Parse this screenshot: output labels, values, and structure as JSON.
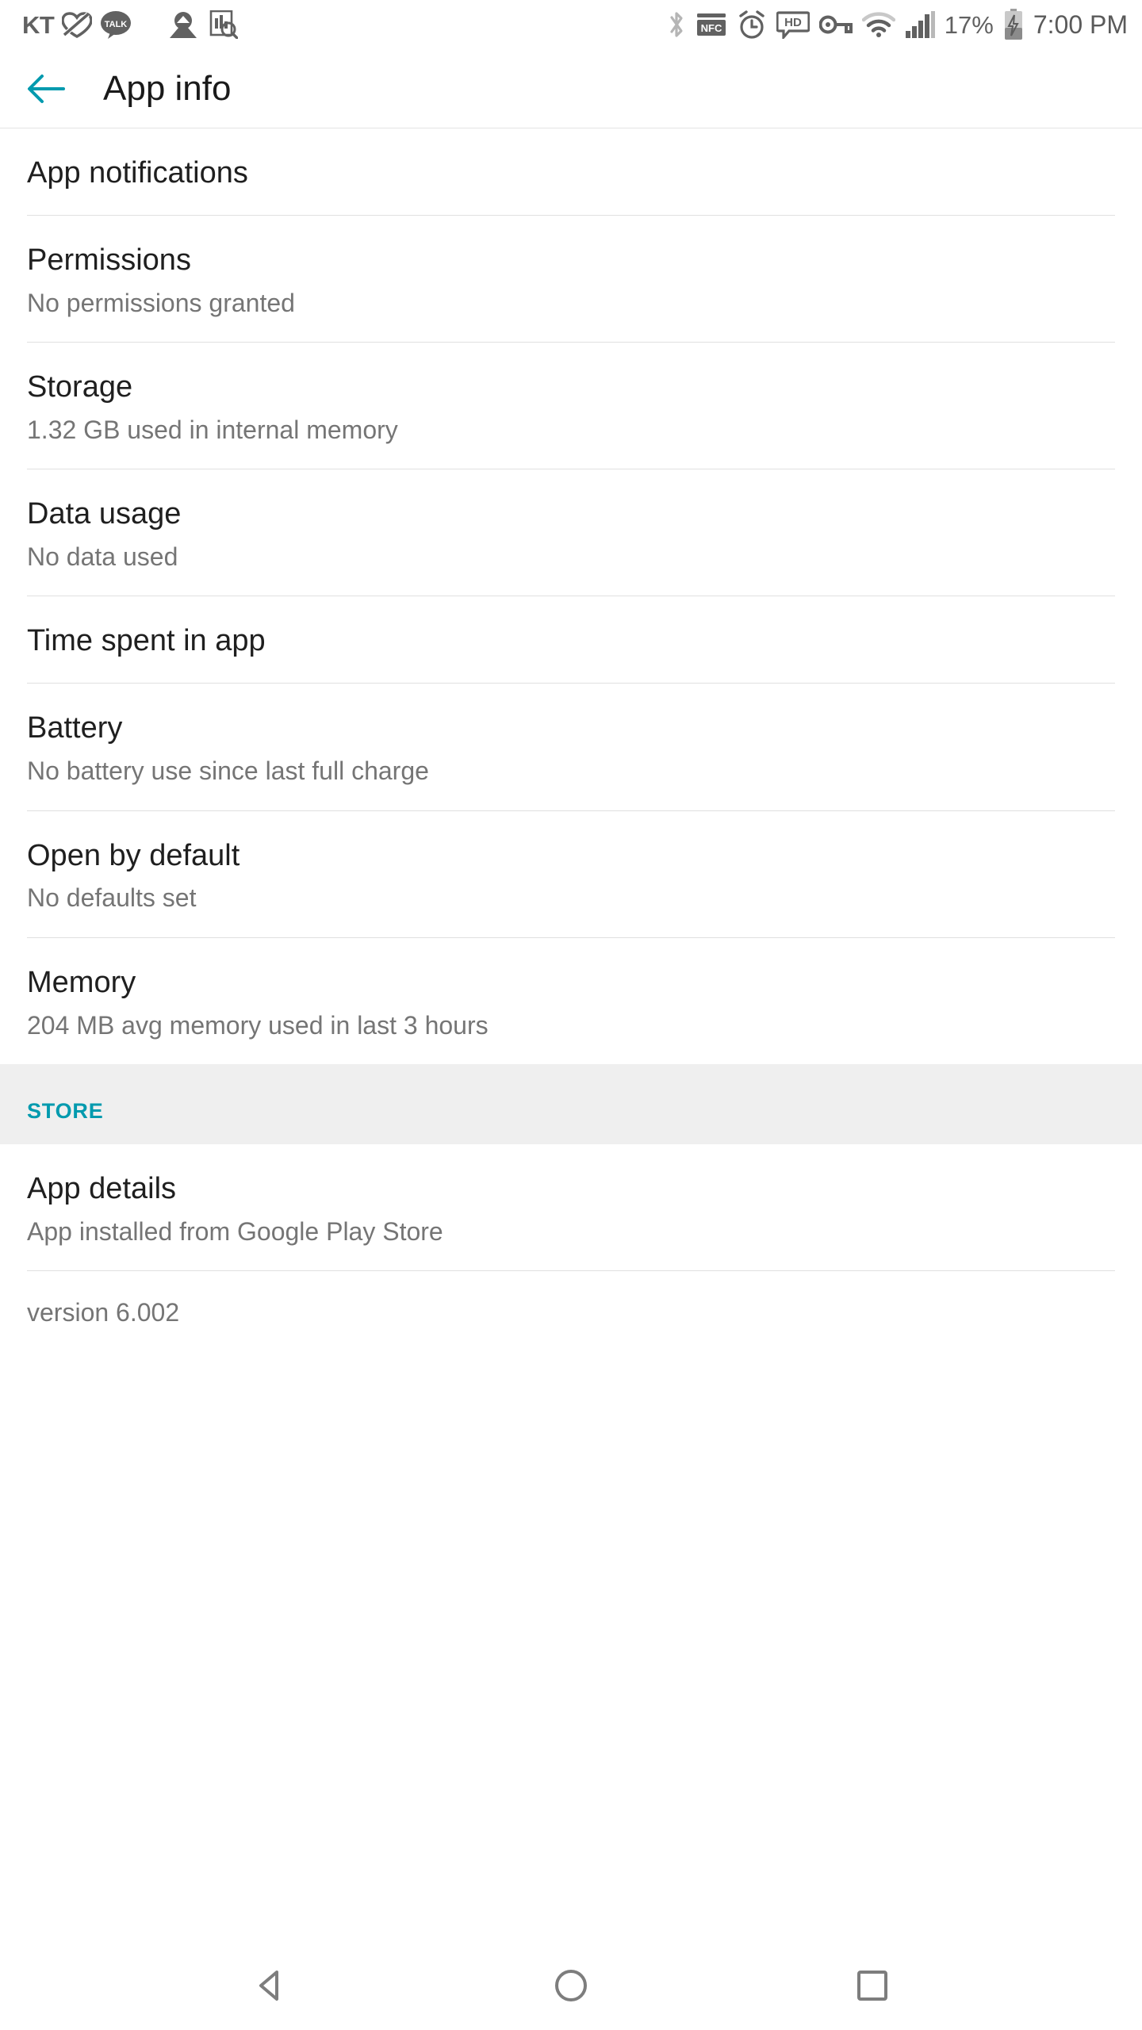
{
  "status_bar": {
    "carrier": "KT",
    "battery_percent": "17%",
    "time": "7:00 PM",
    "left_icons": [
      "kakao-heart-icon",
      "kakaotalk-icon",
      "app-update-icon",
      "chart-search-icon"
    ],
    "right_icons": [
      "bluetooth-icon",
      "nfc-icon",
      "alarm-icon",
      "hd-voice-icon",
      "vpn-key-icon",
      "wifi-icon",
      "cellular-signal-icon",
      "battery-charging-icon"
    ]
  },
  "app_bar": {
    "back_icon": "arrow-left-icon",
    "title": "App info",
    "accent_color": "#009aae"
  },
  "list": {
    "items": [
      {
        "title": "App notifications",
        "subtitle": ""
      },
      {
        "title": "Permissions",
        "subtitle": "No permissions granted"
      },
      {
        "title": "Storage",
        "subtitle": "1.32 GB used in internal memory"
      },
      {
        "title": "Data usage",
        "subtitle": "No data used"
      },
      {
        "title": "Time spent in app",
        "subtitle": ""
      },
      {
        "title": "Battery",
        "subtitle": "No battery use since last full charge"
      },
      {
        "title": "Open by default",
        "subtitle": "No defaults set"
      },
      {
        "title": "Memory",
        "subtitle": "204 MB avg memory used in last 3 hours"
      }
    ]
  },
  "store_section": {
    "header": "STORE",
    "header_color": "#009aae",
    "band_background": "#efefef",
    "items": [
      {
        "title": "App details",
        "subtitle": "App installed from Google Play Store"
      }
    ],
    "version": "version 6.002"
  },
  "nav_bar": {
    "buttons": [
      {
        "name": "back",
        "icon": "triangle-left-icon"
      },
      {
        "name": "home",
        "icon": "circle-icon"
      },
      {
        "name": "recents",
        "icon": "square-icon"
      }
    ]
  }
}
